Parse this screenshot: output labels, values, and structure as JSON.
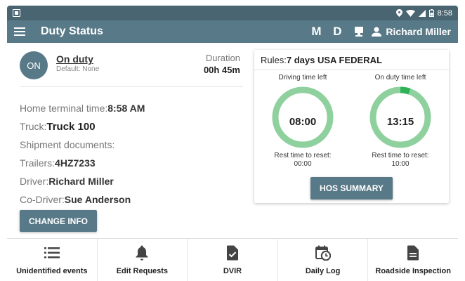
{
  "status_bar": {
    "time": "8:58"
  },
  "header": {
    "title": "Duty Status",
    "mode_m": "M",
    "mode_d": "D",
    "user_name": "Richard  Miller"
  },
  "duty": {
    "badge": "ON",
    "status": "On duty",
    "default_note": "Default: None",
    "duration_label": "Duration",
    "duration_value": "00h 45m"
  },
  "info": {
    "home_terminal_label": "Home terminal time:",
    "home_terminal_value": "8:58 AM",
    "truck_label": "Truck:",
    "truck_value": "Truck 100",
    "shipment_label": "Shipment documents:",
    "trailers_label": "Trailers:",
    "trailers_value": "4HZ7233",
    "driver_label": "Driver:",
    "driver_value": "Richard  Miller",
    "codriver_label": "Co-Driver:",
    "codriver_value": "Sue  Anderson"
  },
  "change_info_button": "CHANGE INFO",
  "rules": {
    "label": "Rules:",
    "value": "7 days USA FEDERAL",
    "driving": {
      "label": "Driving time left",
      "value": "08:00",
      "used_fraction": 0,
      "reset_label": "Rest time to reset:",
      "reset_value": "00:00"
    },
    "on_duty": {
      "label": "On duty time left",
      "value": "13:15",
      "used_fraction": 0.054,
      "reset_label": "Rest time to reset:",
      "reset_value": "10:00"
    },
    "summary_button": "HOS SUMMARY",
    "colors": {
      "track": "#8fd19e",
      "used": "#2eb357"
    }
  },
  "bottom_nav": [
    {
      "label": "Unidentified events",
      "icon": "list-icon"
    },
    {
      "label": "Edit Requests",
      "icon": "bell-icon"
    },
    {
      "label": "DVIR",
      "icon": "clipboard-check-icon"
    },
    {
      "label": "Daily Log",
      "icon": "calendar-clock-icon"
    },
    {
      "label": "Roadside Inspection",
      "icon": "document-icon"
    }
  ],
  "colors": {
    "primary": "#587987",
    "status_bar": "#4a6572"
  }
}
